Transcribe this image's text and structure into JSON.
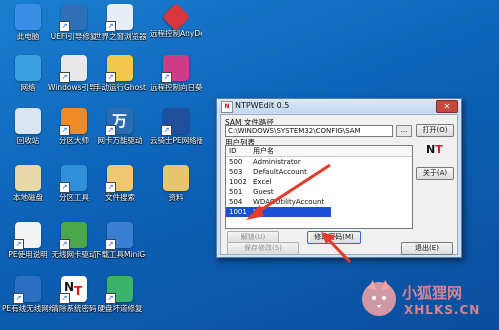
{
  "desktop_icons": [
    {
      "label": "此电脑",
      "color": "#3a8ee6"
    },
    {
      "label": "UEFI引导修复",
      "color": "#2f6fb8"
    },
    {
      "label": "世界之窗浏览器",
      "color": "#e7eef8"
    },
    {
      "label": "远程控制AnyDesk",
      "color": "#d8363a"
    },
    {
      "label": "网络",
      "color": "#3aa0e0"
    },
    {
      "label": "Windows引导修复",
      "color": "#e8e8e8"
    },
    {
      "label": "手动运行Ghost12",
      "color": "#f2c84b"
    },
    {
      "label": "远程控制向日葵",
      "color": "#cf3c8a"
    },
    {
      "label": "回收站",
      "color": "#d9e6f2"
    },
    {
      "label": "分区大师",
      "color": "#f08a24"
    },
    {
      "label": "网卡万能驱动",
      "color": "#2b6cb0"
    },
    {
      "label": "云骑士PE网络版",
      "color": "#1f4e9c"
    },
    {
      "label": "本地磁盘",
      "color": "#e8d9a8"
    },
    {
      "label": "分区工具",
      "color": "#2f8fd8"
    },
    {
      "label": "文件搜索",
      "color": "#f0c870"
    },
    {
      "label": "资料",
      "color": "#e8c46a"
    },
    {
      "label": "PE使用说明",
      "color": "#f2f2f2"
    },
    {
      "label": "无线网卡驱动",
      "color": "#4aa84a"
    },
    {
      "label": "下载工具MiniGet",
      "color": "#3a7fd0"
    },
    {
      "label": "PE有线无线网络",
      "color": "#2a6fc0"
    },
    {
      "label": "清除系统密码",
      "color": "#ffffff"
    },
    {
      "label": "硬盘坏道修复",
      "color": "#3bb36a"
    }
  ],
  "window": {
    "title": "NTPWEdit 0.5",
    "close_label": "✕",
    "app_icon_text": "N",
    "sam_label": "SAM 文件路径",
    "sam_path": "C:\\WINDOWS\\SYSTEM32\\CONFIG\\SAM",
    "browse_label": "...",
    "open_label": "打开(O)",
    "list_label": "用户列表",
    "columns": {
      "id": "ID",
      "name": "用户名"
    },
    "users": [
      {
        "id": "500",
        "name": "Administrator"
      },
      {
        "id": "503",
        "name": "DefaultAccount"
      },
      {
        "id": "1002",
        "name": "Excel"
      },
      {
        "id": "501",
        "name": "Guest"
      },
      {
        "id": "504",
        "name": "WDAGUtilityAccount"
      },
      {
        "id": "1001",
        "name": "XT"
      }
    ],
    "selected_user": "1001",
    "about_label": "关于(A)",
    "unlock_label": "解锁(U)",
    "change_password_label": "修改密码(M)",
    "save_label": "保存修改(S)",
    "exit_label": "退出(E)",
    "logo_n": "N",
    "logo_t": "T"
  },
  "annotation_color": "#e53a2c",
  "watermark": {
    "line1": "小狐狸网",
    "line2": "XHLKS.CN"
  }
}
